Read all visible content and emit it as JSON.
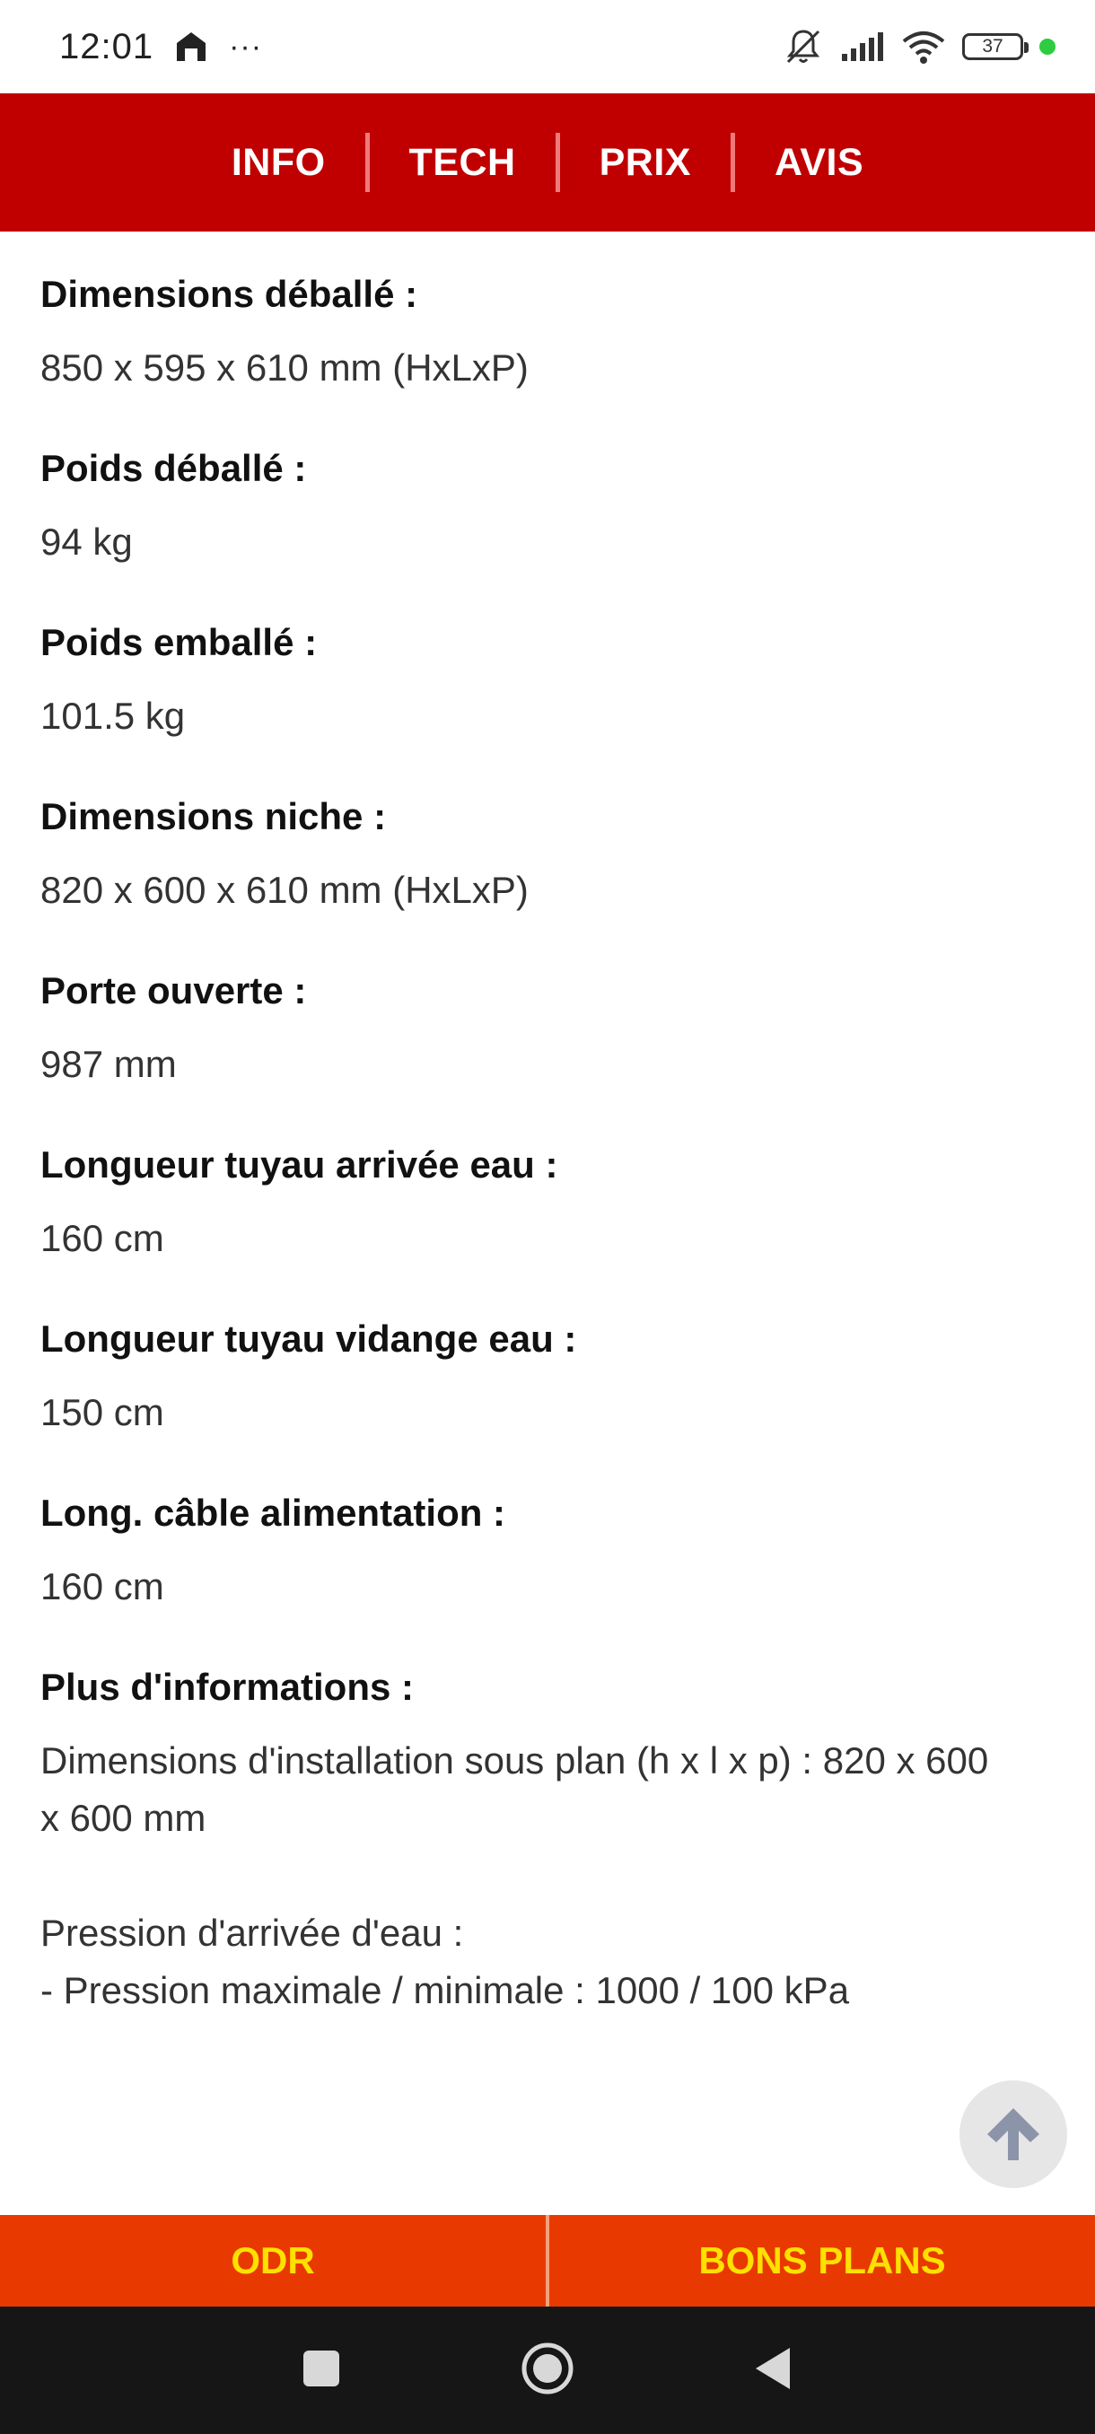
{
  "status_bar": {
    "time": "12:01",
    "more": "···",
    "battery": "37"
  },
  "tabs": [
    {
      "label": "INFO"
    },
    {
      "label": "TECH"
    },
    {
      "label": "PRIX"
    },
    {
      "label": "AVIS"
    }
  ],
  "specs": [
    {
      "label": "Dimensions déballé :",
      "value": "850 x 595 x 610 mm (HxLxP)"
    },
    {
      "label": "Poids déballé :",
      "value": "94 kg"
    },
    {
      "label": "Poids emballé :",
      "value": "101.5 kg"
    },
    {
      "label": "Dimensions niche :",
      "value": "820 x 600 x 610 mm (HxLxP)"
    },
    {
      "label": "Porte ouverte :",
      "value": "987 mm"
    },
    {
      "label": "Longueur tuyau arrivée eau :",
      "value": "160 cm"
    },
    {
      "label": "Longueur tuyau vidange eau :",
      "value": "150 cm"
    },
    {
      "label": "Long. câble alimentation :",
      "value": "160 cm"
    }
  ],
  "more_info": {
    "label": "Plus d'informations :",
    "line1": "Dimensions d'installation sous plan (h x l x p) : 820 x 600 x 600 mm",
    "line2": "Pression d'arrivée d'eau :",
    "line3": "- Pression maximale / minimale : 1000 / 100 kPa"
  },
  "bottom_bar": {
    "left": "ODR",
    "right": "BONS PLANS"
  },
  "colors": {
    "header_red": "#c00000",
    "bottom_orange": "#e83a00",
    "bottom_text_yellow": "#ffe000"
  }
}
